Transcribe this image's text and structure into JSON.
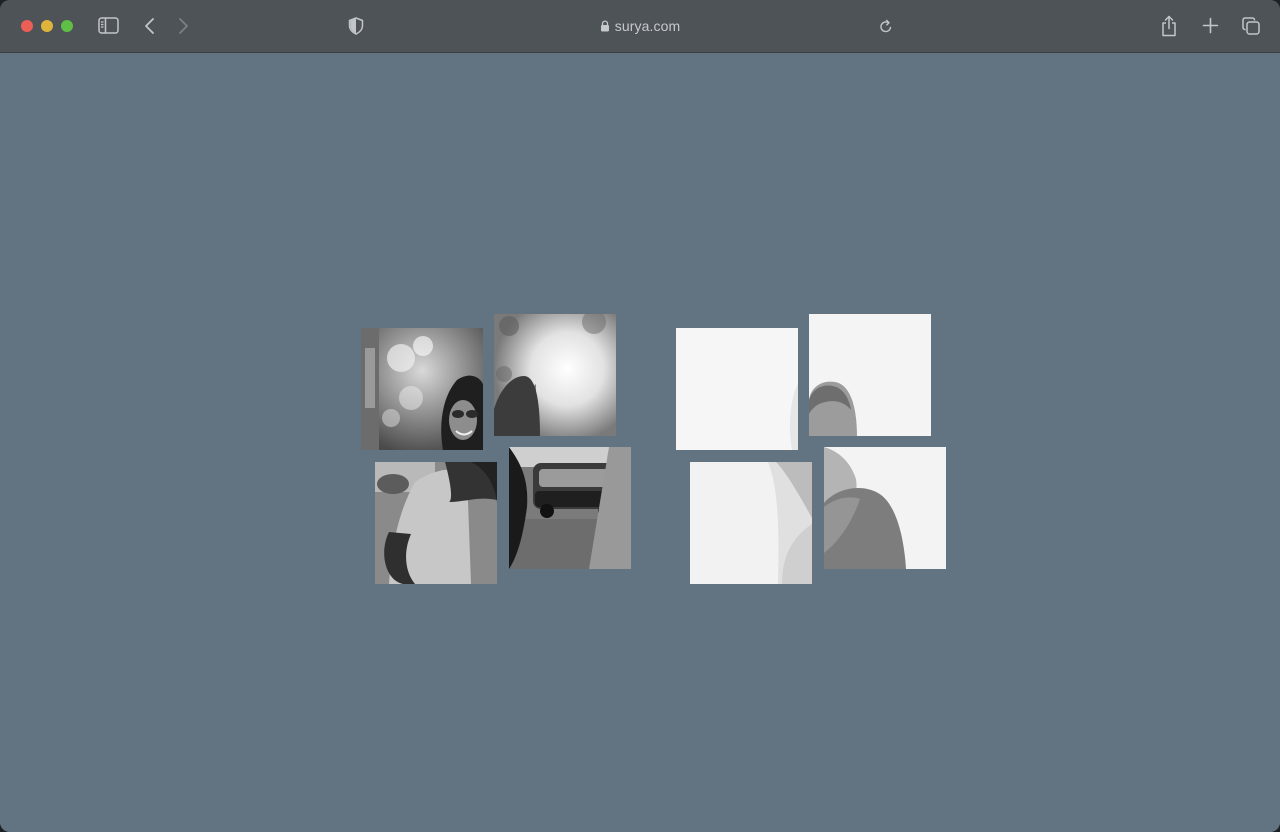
{
  "browser": {
    "url": "surya.com",
    "colors": {
      "toolbar": "#4e5357",
      "page_background": "#627482",
      "close": "#ec5f57",
      "minimize": "#dfb43a",
      "maximize": "#5fbf46"
    },
    "icons": [
      "sidebar-icon",
      "chevron-left-icon",
      "chevron-right-icon",
      "shield-icon",
      "lock-icon",
      "reload-icon",
      "share-icon",
      "plus-icon",
      "tabs-icon"
    ]
  },
  "gallery": {
    "collage_left": {
      "tiles": 4,
      "style": "black-and-white photo of smiling woman with sunglasses on a street"
    },
    "collage_right": {
      "tiles": 4,
      "style": "black-and-white photo of woman with long hair seen from behind on white background"
    }
  }
}
